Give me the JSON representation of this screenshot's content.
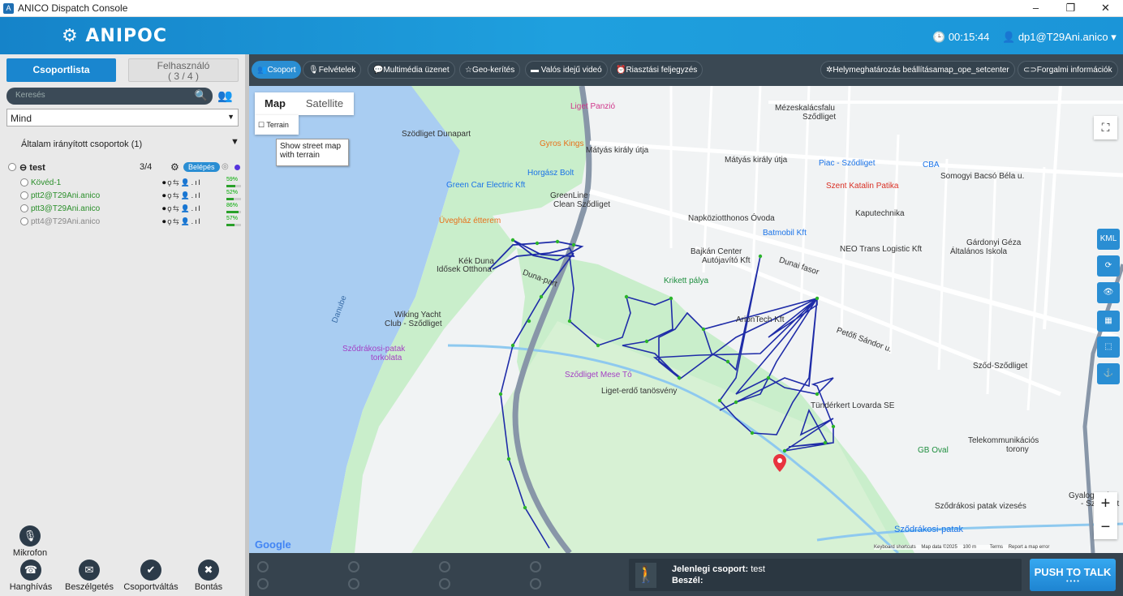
{
  "window": {
    "title": "ANICO Dispatch Console"
  },
  "header": {
    "logo": "ANIPOC",
    "timer": "00:15:44",
    "user": "dp1@T29Ani.anico"
  },
  "left": {
    "tab_groups": "Csoportlista",
    "tab_users_line1": "Felhasználó",
    "tab_users_line2": "( 3 / 4 )",
    "search_placeholder": "Keresés",
    "filter_value": "Mind",
    "managed_label": "Általam irányított csoportok (1)",
    "group": {
      "name": "test",
      "count": "3/4",
      "enter_label": "Belépés"
    },
    "members": [
      {
        "name": "Kövéd-1",
        "battery": "59%",
        "level": 0.59,
        "color": "#2a8f2a"
      },
      {
        "name": "ptt2@T29Ani.anico",
        "battery": "52%",
        "level": 0.52,
        "color": "#2a8f2a"
      },
      {
        "name": "ptt3@T29Ani.anico",
        "battery": "86%",
        "level": 0.86,
        "color": "#2a8f2a"
      },
      {
        "name": "ptt4@T29Ani.anico",
        "battery": "57%",
        "level": 0.57,
        "color": "#888888"
      }
    ],
    "mic_label": "Mikrofon",
    "buttons": [
      "Hanghívás",
      "Beszélgetés",
      "Csoportváltás",
      "Bontás"
    ]
  },
  "toolbar": {
    "items": [
      "Csoport",
      "Felvételek",
      "Multimédia üzenet",
      "Geo-kerítés",
      "Valós idejű videó",
      "Riasztási feljegyzés"
    ],
    "right_items": [
      "Helymeghatározás beállításamap_ope_setcenter",
      "Forgalmi információk"
    ]
  },
  "map": {
    "type_map": "Map",
    "type_satellite": "Satellite",
    "terrain": "Terrain",
    "tooltip_line1": "Show street map",
    "tooltip_line2": "with terrain",
    "side_kml": "KML",
    "google": "Google",
    "attribution": "Keyboard shortcuts    Map data ©2025    100 m          Terms    Report a map error",
    "labels": [
      {
        "t": "Liget Panzió",
        "c": "#d0368a"
      },
      {
        "t": "Szödliget Dunapart",
        "c": "#333"
      },
      {
        "t": "Gyros Kings",
        "c": "#e8701a"
      },
      {
        "t": "Horgász Bolt",
        "c": "#1a73e8"
      },
      {
        "t": "Green Car Electric Kft",
        "c": "#1a73e8"
      },
      {
        "t": "GreenLine",
        "c": "#333"
      },
      {
        "t": "Clean Sződliget",
        "c": "#333"
      },
      {
        "t": "Üvegház étterem",
        "c": "#e8701a"
      },
      {
        "t": "Kék Duna",
        "c": "#333"
      },
      {
        "t": "Idősek Otthona",
        "c": "#333"
      },
      {
        "t": "Wiking Yacht",
        "c": "#333"
      },
      {
        "t": "Club - Sződliget",
        "c": "#333"
      },
      {
        "t": "Sződrákosi-patak",
        "c": "#a33fc4"
      },
      {
        "t": "torkolata",
        "c": "#a33fc4"
      },
      {
        "t": "Sződliget Mese Tó",
        "c": "#a33fc4"
      },
      {
        "t": "Liget-erdő tanösvény",
        "c": "#333"
      },
      {
        "t": "Krikett pálya",
        "c": "#1e8e3e"
      },
      {
        "t": "Bajkán Center",
        "c": "#333"
      },
      {
        "t": "Autójavító Kft",
        "c": "#333"
      },
      {
        "t": "Napköziotthonos Óvoda",
        "c": "#333"
      },
      {
        "t": "Batmobil Kft",
        "c": "#1a73e8"
      },
      {
        "t": "Mézeskalácsfalu",
        "c": "#333"
      },
      {
        "t": "Sződliget",
        "c": "#333"
      },
      {
        "t": "Mátyás király útja",
        "c": "#333"
      },
      {
        "t": "Mátyás király útja",
        "c": "#333"
      },
      {
        "t": "Piac - Sződliget",
        "c": "#1a73e8"
      },
      {
        "t": "CBA",
        "c": "#1a73e8"
      },
      {
        "t": "Szent Katalin Patika",
        "c": "#d93025"
      },
      {
        "t": "Kaputechnika",
        "c": "#333"
      },
      {
        "t": "NEO Trans Logistic Kft",
        "c": "#333"
      },
      {
        "t": "Gárdonyi Géza",
        "c": "#333"
      },
      {
        "t": "Általános Iskola",
        "c": "#333"
      },
      {
        "t": "Tündérkert Lovarda SE",
        "c": "#333"
      },
      {
        "t": "GB Oval",
        "c": "#1e8e3e"
      },
      {
        "t": "Telekommunikációs",
        "c": "#333"
      },
      {
        "t": "torony",
        "c": "#333"
      },
      {
        "t": "Sződ-Sződliget",
        "c": "#333"
      },
      {
        "t": "Sződrákosi patak vizesés",
        "c": "#333"
      },
      {
        "t": "Sződrákosi-patak",
        "c": "#1a73e8"
      },
      {
        "t": "Dunai fasor",
        "c": "#333"
      },
      {
        "t": "Petőfi Sándor u.",
        "c": "#333"
      },
      {
        "t": "Somogyi Bacsó Béla u.",
        "c": "#333"
      },
      {
        "t": "Danube",
        "c": "#3b6ea8"
      },
      {
        "t": "Gyalogos és",
        "c": "#333"
      },
      {
        "t": "- Sződliget",
        "c": "#333"
      },
      {
        "t": "ArionTech Kft",
        "c": "#333"
      },
      {
        "t": "Duna-part",
        "c": "#333"
      }
    ]
  },
  "bottom": {
    "current_group_label": "Jelenlegi csoport:",
    "current_group_value": "test",
    "speak_label": "Beszél:",
    "ptt_label": "PUSH TO TALK",
    "ptt_dots": "• • • •"
  },
  "colors": {
    "accent": "#1a86cf",
    "toolbar": "#3a4853",
    "track": "#1f2ca8",
    "points": "#2bb42b"
  }
}
